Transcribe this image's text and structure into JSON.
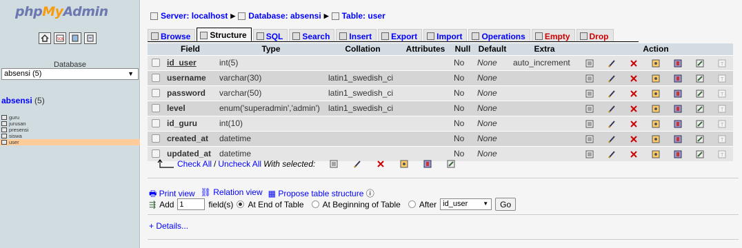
{
  "sidebar": {
    "logo": {
      "part1": "php",
      "part2": "My",
      "part3": "Admin"
    },
    "db_label": "Database",
    "db_select": "absensi (5)",
    "current_db": {
      "name": "absensi",
      "count": "(5)"
    },
    "tables": [
      "guru",
      "jurusan",
      "presensi",
      "siswa",
      "user"
    ],
    "active_table": "user"
  },
  "breadcrumb": {
    "server": "Server: localhost",
    "database": "Database: absensi",
    "table": "Table: user"
  },
  "tabs": [
    "Browse",
    "Structure",
    "SQL",
    "Search",
    "Insert",
    "Export",
    "Import",
    "Operations",
    "Empty",
    "Drop"
  ],
  "active_tab": "Structure",
  "columns": [
    "Field",
    "Type",
    "Collation",
    "Attributes",
    "Null",
    "Default",
    "Extra",
    "Action"
  ],
  "rows": [
    {
      "field": "id_user",
      "type": "int(5)",
      "collation": "",
      "attributes": "",
      "null": "No",
      "default": "None",
      "extra": "auto_increment"
    },
    {
      "field": "username",
      "type": "varchar(30)",
      "collation": "latin1_swedish_ci",
      "attributes": "",
      "null": "No",
      "default": "None",
      "extra": ""
    },
    {
      "field": "password",
      "type": "varchar(50)",
      "collation": "latin1_swedish_ci",
      "attributes": "",
      "null": "No",
      "default": "None",
      "extra": ""
    },
    {
      "field": "level",
      "type": "enum('superadmin','admin')",
      "collation": "latin1_swedish_ci",
      "attributes": "",
      "null": "No",
      "default": "None",
      "extra": ""
    },
    {
      "field": "id_guru",
      "type": "int(10)",
      "collation": "",
      "attributes": "",
      "null": "No",
      "default": "None",
      "extra": ""
    },
    {
      "field": "created_at",
      "type": "datetime",
      "collation": "",
      "attributes": "",
      "null": "No",
      "default": "None",
      "extra": ""
    },
    {
      "field": "updated_at",
      "type": "datetime",
      "collation": "",
      "attributes": "",
      "null": "No",
      "default": "None",
      "extra": ""
    }
  ],
  "with_selected": {
    "check_all": "Check All",
    "slash": "/",
    "uncheck_all": "Uncheck All",
    "label": "With selected:"
  },
  "links": {
    "print_view": "Print view",
    "relation_view": "Relation view",
    "propose": "Propose table structure"
  },
  "add_field": {
    "label": "Add",
    "value": "1",
    "fields_label": "field(s)",
    "end": "At End of Table",
    "beginning": "At Beginning of Table",
    "after": "After",
    "after_value": "id_user",
    "go": "Go"
  },
  "details": "+ Details..."
}
